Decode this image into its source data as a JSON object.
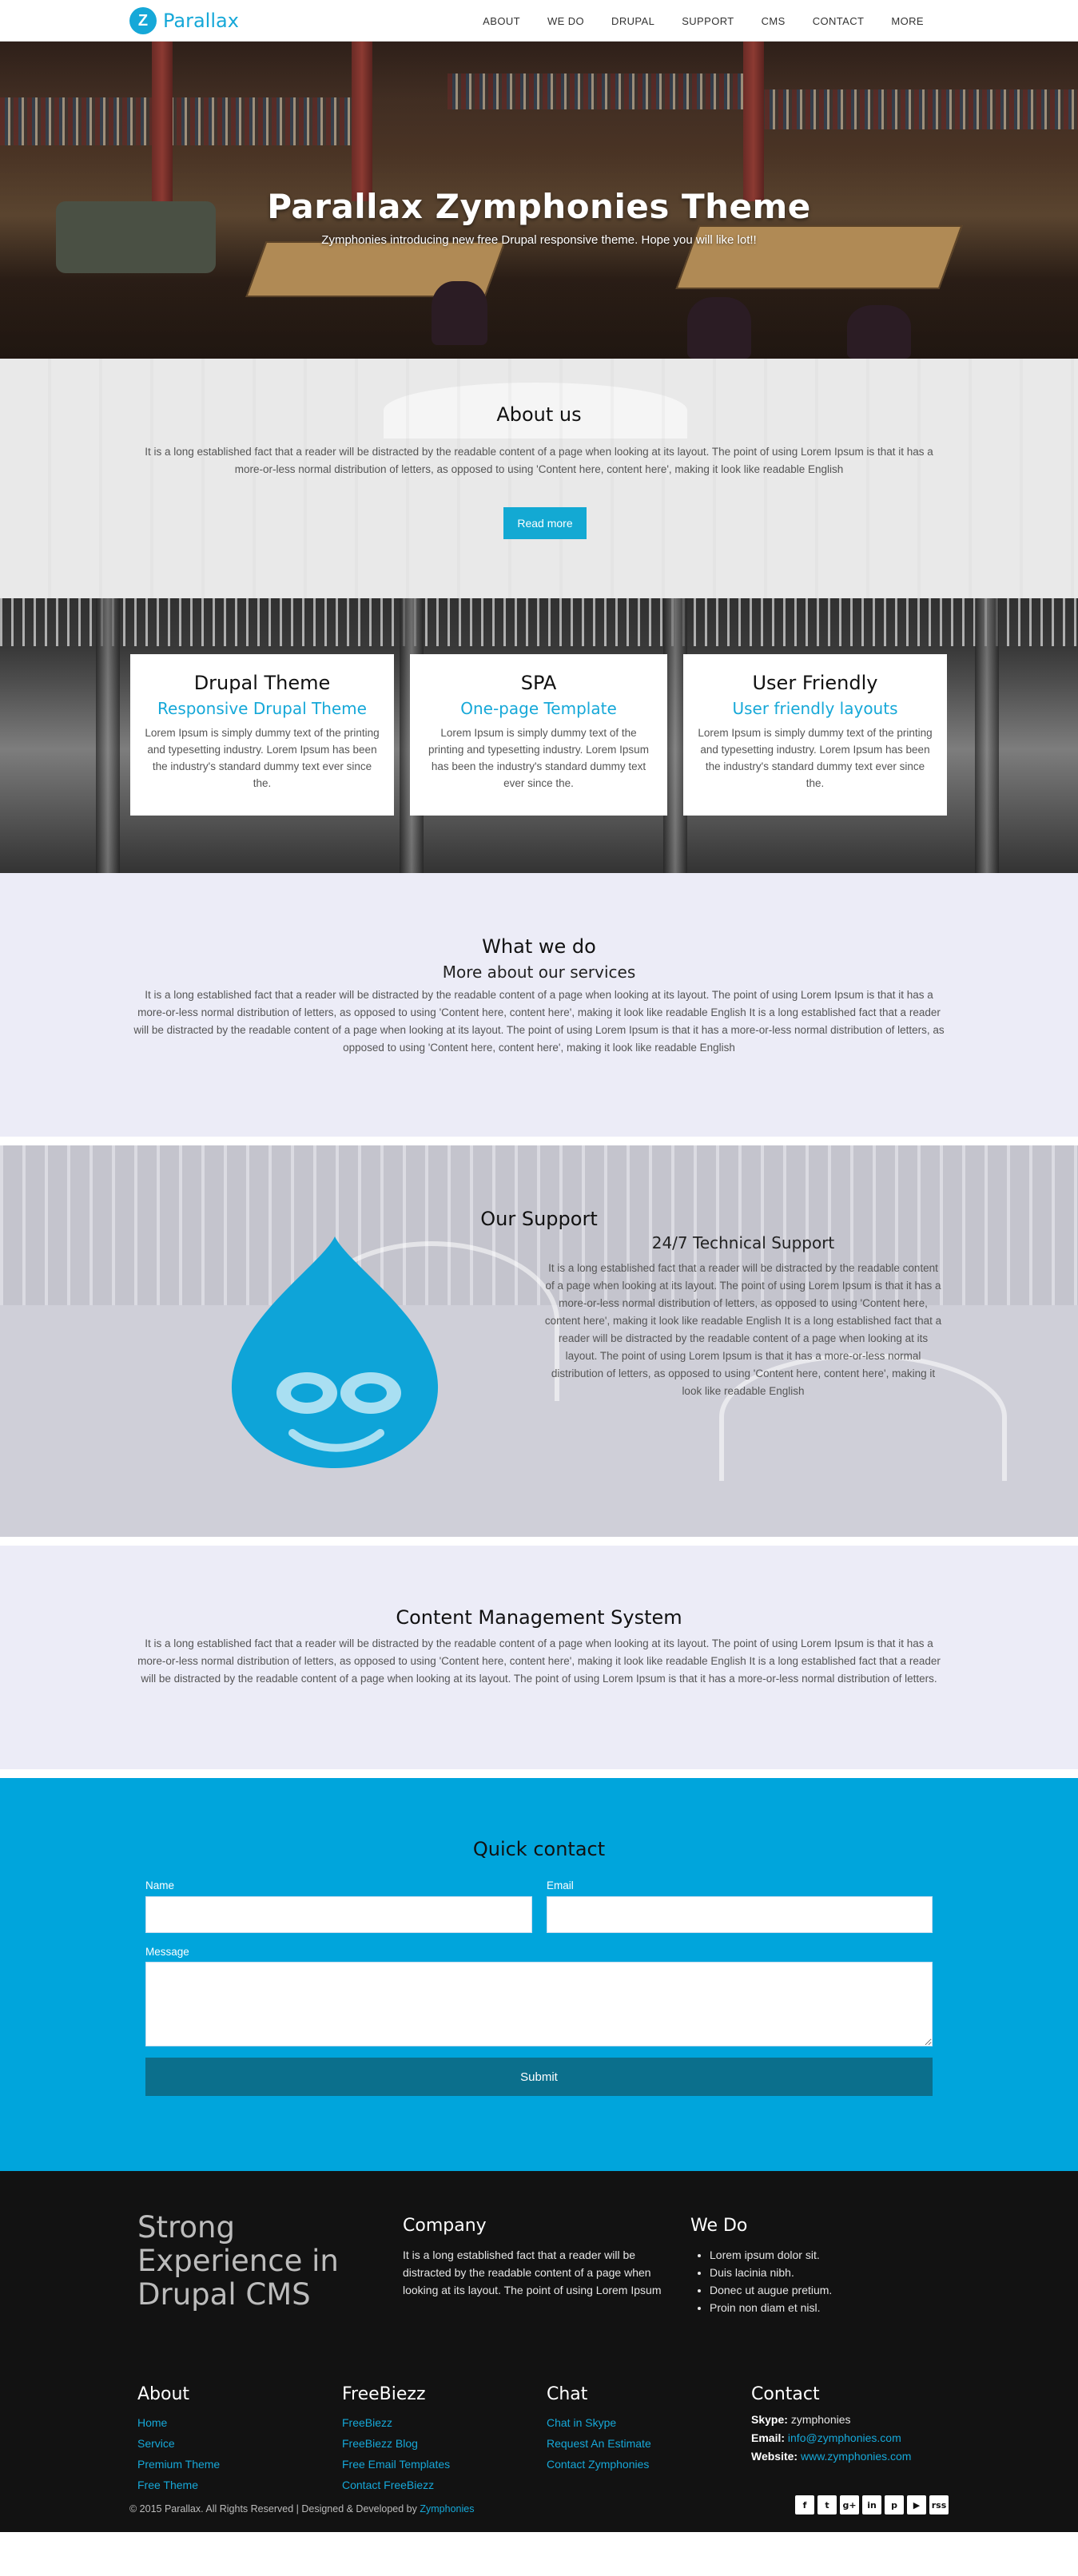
{
  "brand": {
    "logo_letter": "Z",
    "name": "Parallax"
  },
  "nav": {
    "items": [
      "ABOUT",
      "WE DO",
      "DRUPAL",
      "SUPPORT",
      "CMS",
      "CONTACT",
      "MORE"
    ]
  },
  "hero": {
    "title": "Parallax Zymphonies Theme",
    "subtitle": "Zymphonies introducing new free Drupal responsive theme. Hope you will like lot!!"
  },
  "about": {
    "title": "About us",
    "text": "It is a long established fact that a reader will be distracted by the readable content of a page when looking at its layout. The point of using Lorem Ipsum is that it has a more-or-less normal distribution of letters, as opposed to using 'Content here, content here', making it look like readable English",
    "button": "Read more"
  },
  "features": [
    {
      "title": "Drupal Theme",
      "subtitle": "Responsive Drupal Theme",
      "text": "Lorem Ipsum is simply dummy text of the printing and typesetting industry. Lorem Ipsum has been the industry's standard dummy text ever since the."
    },
    {
      "title": "SPA",
      "subtitle": "One-page Template",
      "text": "Lorem Ipsum is simply dummy text of the printing and typesetting industry. Lorem Ipsum has been the industry's standard dummy text ever since the."
    },
    {
      "title": "User Friendly",
      "subtitle": "User friendly layouts",
      "text": "Lorem Ipsum is simply dummy text of the printing and typesetting industry. Lorem Ipsum has been the industry's standard dummy text ever since the."
    }
  ],
  "whatwedo": {
    "title": "What we do",
    "subtitle": "More about our services",
    "text": "It is a long established fact that a reader will be distracted by the readable content of a page when looking at its layout. The point of using Lorem Ipsum is that it has a more-or-less normal distribution of letters, as opposed to using 'Content here, content here', making it look like readable English It is a long established fact that a reader will be distracted by the readable content of a page when looking at its layout. The point of using Lorem Ipsum is that it has a more-or-less normal distribution of letters, as opposed to using 'Content here, content here', making it look like readable English"
  },
  "support": {
    "title": "Our Support",
    "subtitle": "24/7 Technical Support",
    "text": "It is a long established fact that a reader will be distracted by the readable content of a page when looking at its layout. The point of using Lorem Ipsum is that it has a more-or-less normal distribution of letters, as opposed to using 'Content here, content here', making it look like readable English It is a long established fact that a reader will be distracted by the readable content of a page when looking at its layout. The point of using Lorem Ipsum is that it has a more-or-less normal distribution of letters, as opposed to using 'Content here, content here', making it look like readable English",
    "icon": "drupal-drop-icon"
  },
  "cms": {
    "title": "Content Management System",
    "text": "It is a long established fact that a reader will be distracted by the readable content of a page when looking at its layout. The point of using Lorem Ipsum is that it has a more-or-less normal distribution of letters, as opposed to using 'Content here, content here', making it look like readable English It is a long established fact that a reader will be distracted by the readable content of a page when looking at its layout. The point of using Lorem Ipsum is that it has a more-or-less normal distribution of letters."
  },
  "contact": {
    "title": "Quick contact",
    "name_label": "Name",
    "email_label": "Email",
    "message_label": "Message",
    "submit": "Submit"
  },
  "footer": {
    "tagline": "Strong Experience in Drupal CMS",
    "company": {
      "title": "Company",
      "text": "It is a long established fact that a reader will be distracted by the readable content of a page when looking at its layout. The point of using Lorem Ipsum"
    },
    "wedo": {
      "title": "We Do",
      "items": [
        "Lorem ipsum dolor sit.",
        "Duis lacinia nibh.",
        "Donec ut augue pretium.",
        "Proin non diam et nisl."
      ]
    },
    "about": {
      "title": "About",
      "links": [
        "Home",
        "Service",
        "Premium Theme",
        "Free Theme"
      ]
    },
    "freebiezz": {
      "title": "FreeBiezz",
      "links": [
        "FreeBiezz",
        "FreeBiezz Blog",
        "Free Email Templates",
        "Contact FreeBiezz"
      ]
    },
    "chat": {
      "title": "Chat",
      "links": [
        "Chat in Skype",
        "Request An Estimate",
        "Contact Zymphonies"
      ]
    },
    "contact": {
      "title": "Contact",
      "skype_label": "Skype:",
      "skype": "zymphonies",
      "email_label": "Email:",
      "email": "info@zymphonies.com",
      "website_label": "Website:",
      "website": "www.zymphonies.com"
    },
    "copyright": "© 2015 Parallax. All Rights Reserved | Designed & Developed by",
    "copyright_link": "Zymphonies",
    "social": [
      {
        "icon": "facebook-icon",
        "glyph": "f"
      },
      {
        "icon": "twitter-icon",
        "glyph": "t"
      },
      {
        "icon": "google-plus-icon",
        "glyph": "g+"
      },
      {
        "icon": "linkedin-icon",
        "glyph": "in"
      },
      {
        "icon": "pinterest-icon",
        "glyph": "p"
      },
      {
        "icon": "youtube-icon",
        "glyph": "▶"
      },
      {
        "icon": "rss-icon",
        "glyph": "rss"
      }
    ]
  },
  "colors": {
    "accent": "#16a8d8",
    "contact_bg": "#00a5dc",
    "submit_bg": "#0b6f8c",
    "footer_bg": "#121212"
  }
}
